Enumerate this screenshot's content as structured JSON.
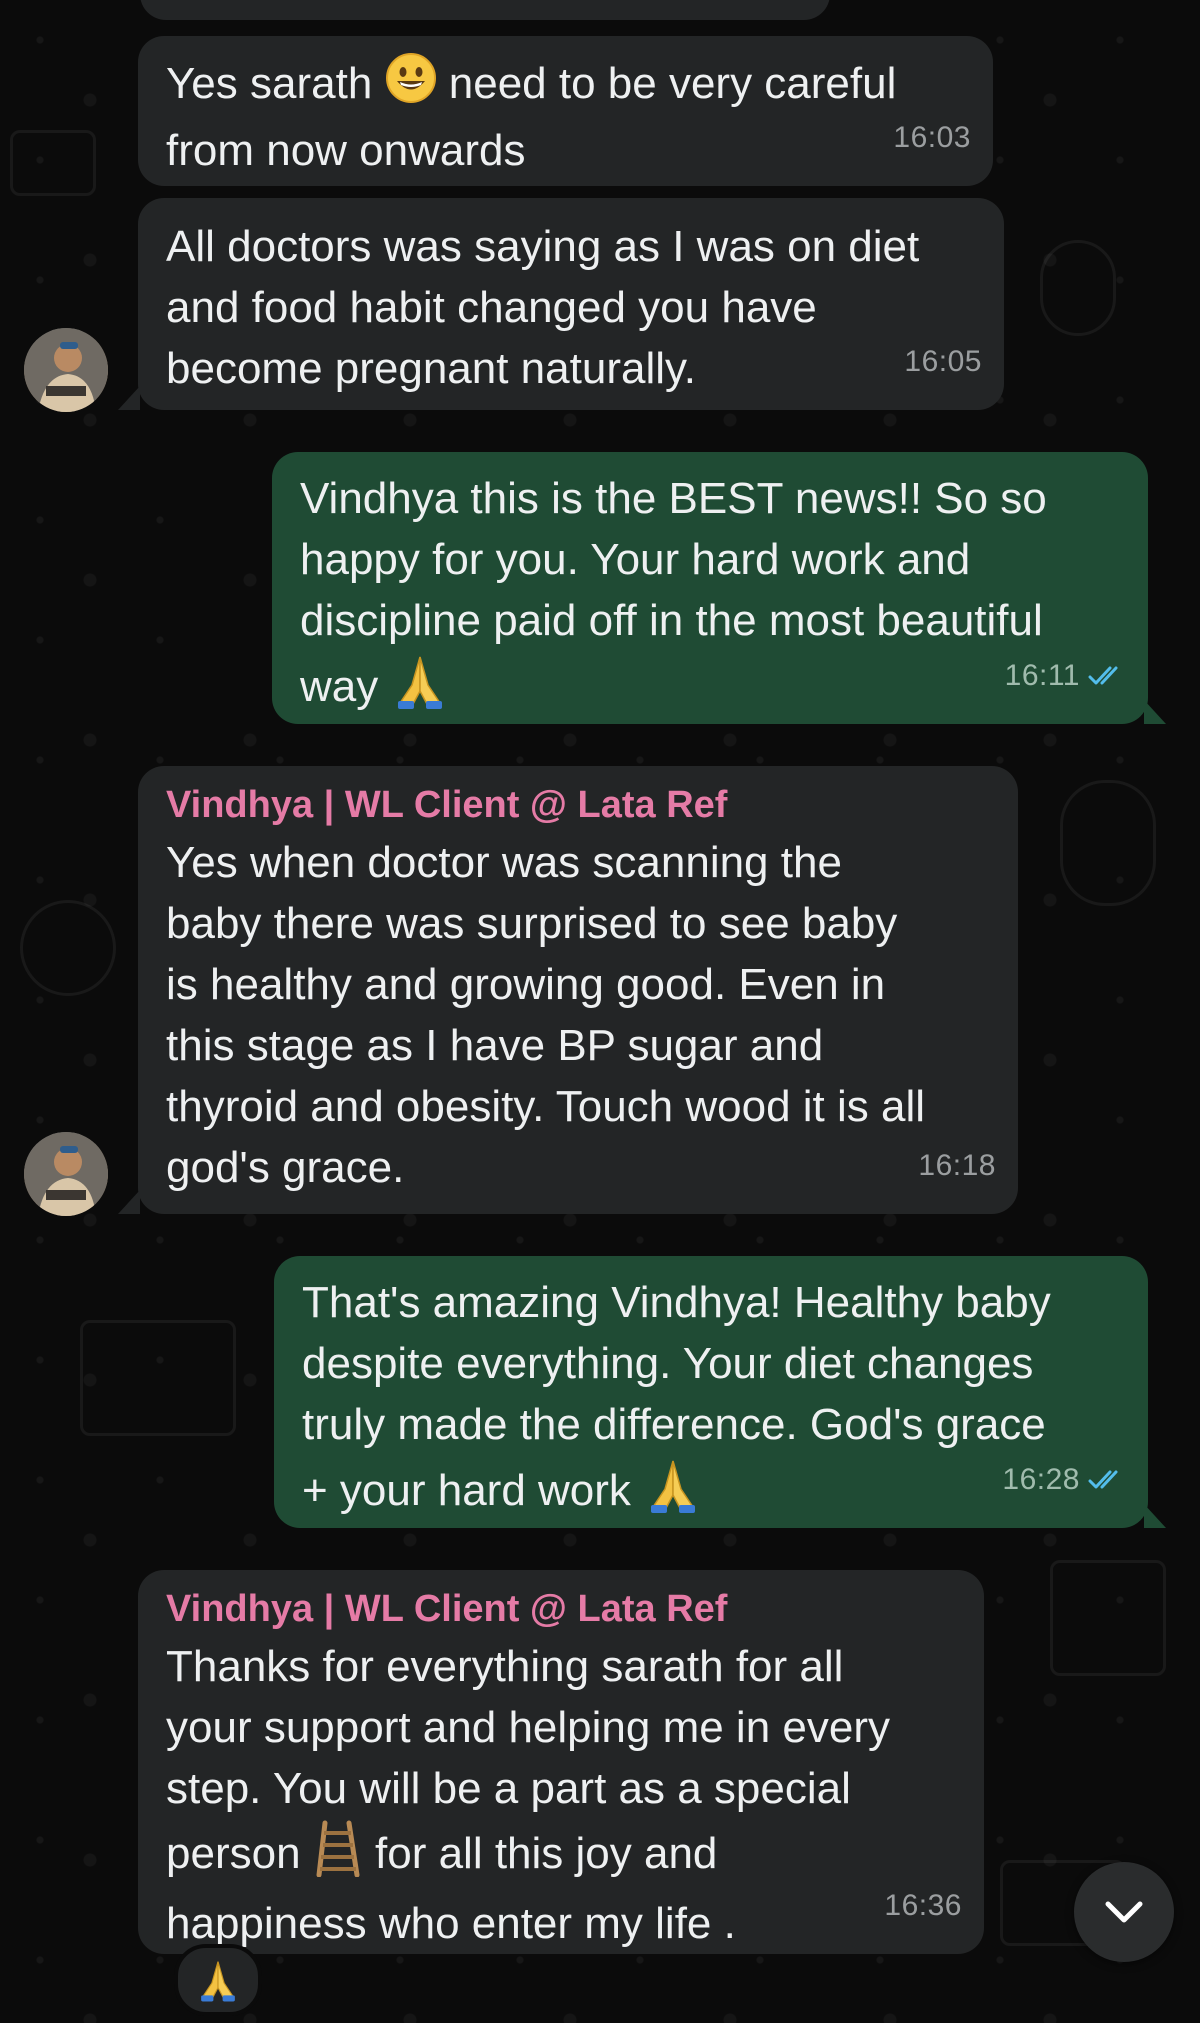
{
  "messages": [
    {
      "text": "",
      "time": ""
    },
    {
      "text_before": "Yes sarath",
      "emoji": "grinning-face",
      "text_after": " need to be very careful\nfrom now onwards",
      "time": "16:03"
    },
    {
      "text": "All doctors was saying as I was on diet\nand food habit changed you have\nbecome pregnant naturally.",
      "time": "16:05"
    },
    {
      "text": "Vindhya this is the BEST news!! So so\nhappy for you. Your hard work and\ndiscipline paid off in the most beautiful\nway",
      "emoji": "folded-hands",
      "time": "16:11",
      "status": "read"
    },
    {
      "sender": "Vindhya | WL Client @ Lata Ref",
      "text": "Yes when doctor was scanning the\nbaby there was surprised to see baby\nis healthy and growing good. Even in\nthis stage as I have BP sugar and\nthyroid and obesity. Touch wood it is all\ngod's grace.",
      "time": "16:18"
    },
    {
      "text": "That's amazing Vindhya! Healthy baby\ndespite everything. Your diet changes\ntruly made the difference. God's grace\n+ your hard work",
      "emoji": "folded-hands",
      "time": "16:28",
      "status": "read"
    },
    {
      "sender": "Vindhya | WL Client @ Lata Ref",
      "text_line1": "Thanks for everything sarath for all\nyour support and helping me in every\nstep. You will be a part as a special",
      "text_line2_before": "person",
      "emoji": "ladder",
      "text_line2_after": " for all this joy and\nhappiness who enter my life .",
      "time": "16:36",
      "reaction": "folded-hands"
    }
  ],
  "colors": {
    "background": "#0b0b0b",
    "incoming_bubble": "#232526",
    "outgoing_bubble": "#1f4b34",
    "sender_name": "#e57ba6",
    "read_ticks": "#53bdeb"
  },
  "icons": {
    "scroll_down": "chevron-down-icon",
    "read_receipt": "double-check-icon"
  }
}
